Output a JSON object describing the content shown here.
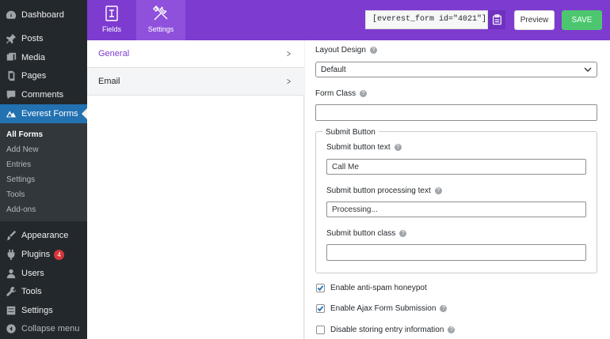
{
  "sidebar": {
    "items": [
      {
        "label": "Dashboard",
        "icon": "dashboard-icon"
      },
      {
        "label": "Posts",
        "icon": "pin-icon"
      },
      {
        "label": "Media",
        "icon": "media-icon"
      },
      {
        "label": "Pages",
        "icon": "pages-icon"
      },
      {
        "label": "Comments",
        "icon": "comments-icon"
      },
      {
        "label": "Everest Forms",
        "icon": "everest-forms-icon"
      },
      {
        "label": "Appearance",
        "icon": "paintbrush-icon"
      },
      {
        "label": "Plugins",
        "icon": "plugins-icon",
        "badge": "4"
      },
      {
        "label": "Users",
        "icon": "users-icon"
      },
      {
        "label": "Tools",
        "icon": "tools-icon"
      },
      {
        "label": "Settings",
        "icon": "settings-icon"
      },
      {
        "label": "Collapse menu",
        "icon": "collapse-icon"
      }
    ],
    "submenu": [
      "All Forms",
      "Add New",
      "Entries",
      "Settings",
      "Tools",
      "Add-ons"
    ]
  },
  "header": {
    "tabs": [
      {
        "label": "Fields"
      },
      {
        "label": "Settings"
      }
    ],
    "shortcode": "[everest_form id=\"4021\"]",
    "preview_label": "Preview",
    "save_label": "SAVE",
    "accent": "#7e3bd0",
    "save_color": "#4cc76f"
  },
  "nav": {
    "items": [
      {
        "label": "General",
        "chevron": ">"
      },
      {
        "label": "Email",
        "chevron": ">"
      }
    ]
  },
  "panel": {
    "layout_design_label": "Layout Design",
    "layout_design_value": "Default",
    "form_class_label": "Form Class",
    "form_class_value": "",
    "submit_button_legend": "Submit Button",
    "submit_text_label": "Submit button text",
    "submit_text_value": "Call Me",
    "processing_text_label": "Submit button processing text",
    "processing_text_value": "Processing...",
    "submit_class_label": "Submit button class",
    "submit_class_value": "",
    "checkboxes": [
      {
        "label": "Enable anti-spam honeypot",
        "checked": true
      },
      {
        "label": "Enable Ajax Form Submission",
        "checked": true
      },
      {
        "label": "Disable storing entry information",
        "checked": false
      }
    ],
    "help_glyph": "?"
  }
}
